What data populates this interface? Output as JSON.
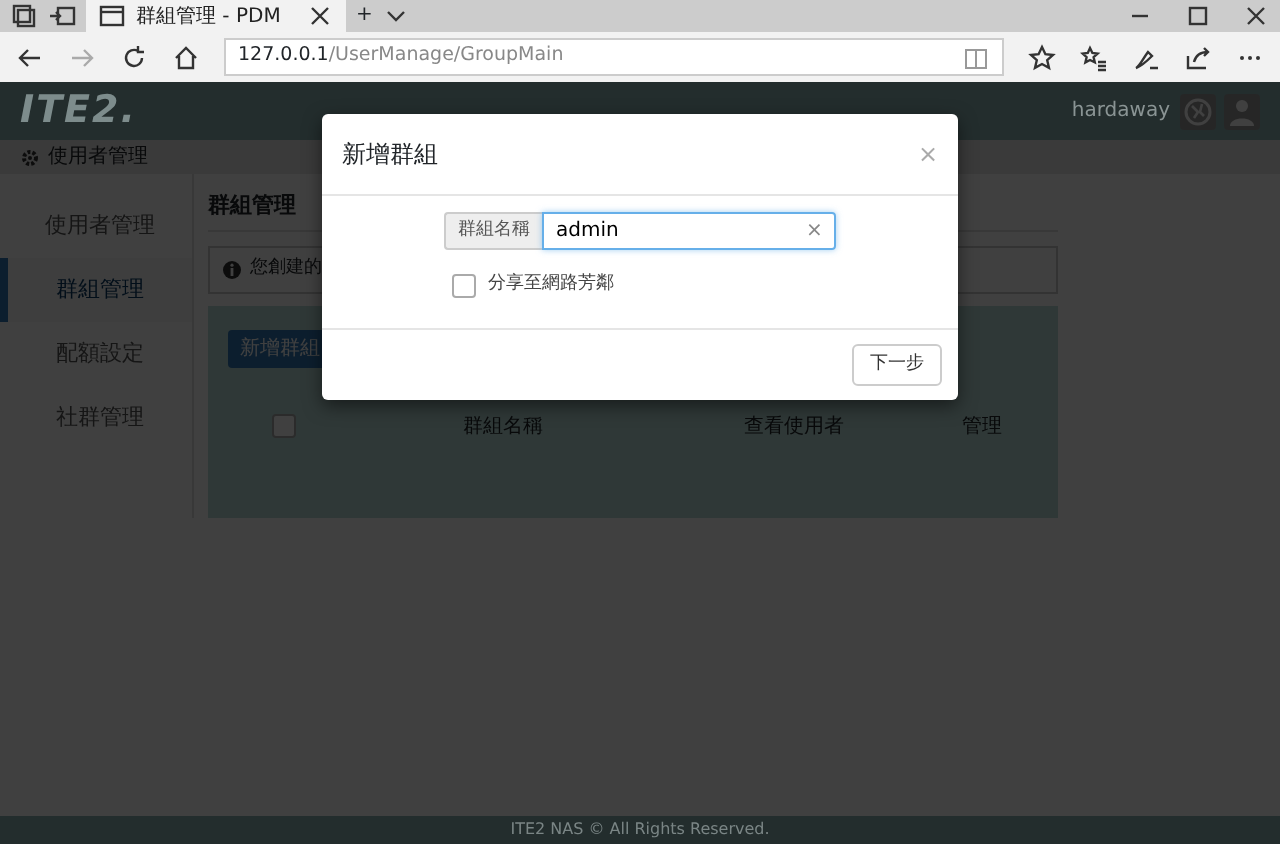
{
  "browser": {
    "tabs": [
      {
        "title": "群組管理 - PDM",
        "selected": true
      }
    ],
    "new_tab": "+",
    "address": {
      "host": "127.0.0.1",
      "path": "/UserManage/GroupMain"
    }
  },
  "app": {
    "logo": "ITE2.",
    "user": "hardaway",
    "breadcrumb": "使用者管理",
    "sidebar": [
      {
        "label": "使用者管理",
        "selected": false
      },
      {
        "label": "群組管理",
        "selected": true
      },
      {
        "label": "配額設定",
        "selected": false
      },
      {
        "label": "社群管理",
        "selected": false
      }
    ],
    "page_title": "群組管理",
    "info": "您創建的",
    "add_button": "新增群組",
    "table": {
      "select_all": {
        "checked": false
      },
      "columns": [
        "群組名稱",
        "查看使用者",
        "管理"
      ]
    },
    "footer": "ITE2 NAS © All Rights Reserved."
  },
  "modal": {
    "title": "新增群組",
    "close": "×",
    "field": {
      "label": "群組名稱",
      "value": "admin",
      "clear": "×"
    },
    "share": {
      "label": "分享至網路芳鄰",
      "checked": false
    },
    "next_button": "下一步"
  }
}
